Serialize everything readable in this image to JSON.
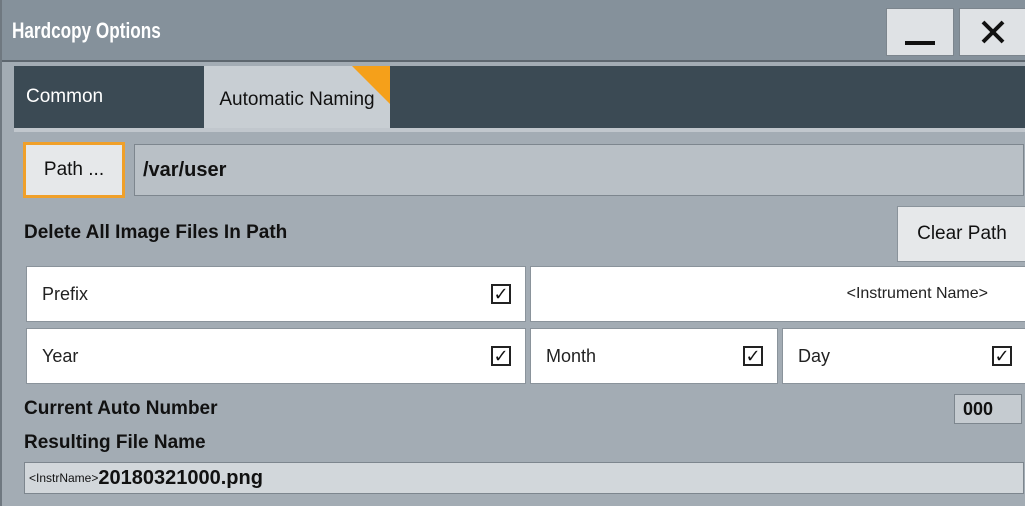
{
  "window": {
    "title": "Hardcopy Options",
    "minimize_icon": "minimize-icon",
    "close_icon": "close-icon",
    "close_glyph": "✕"
  },
  "tabs": [
    {
      "label": "Common",
      "active": false
    },
    {
      "label": "Automatic Naming",
      "active": true
    }
  ],
  "colors": {
    "accent": "#f5a01a",
    "titlebar": "#85919b",
    "tabbar": "#3b4a54",
    "panel": "#a3acb4"
  },
  "path": {
    "button_label": "Path ...",
    "value": "/var/user"
  },
  "delete": {
    "label": "Delete All Image Files In Path",
    "button_label": "Clear Path"
  },
  "naming": {
    "prefix": {
      "label": "Prefix",
      "checked": true,
      "value": "<Instrument Name>"
    },
    "year": {
      "label": "Year",
      "checked": true
    },
    "month": {
      "label": "Month",
      "checked": true
    },
    "day": {
      "label": "Day",
      "checked": true
    },
    "check_glyph": "✓"
  },
  "auto_number": {
    "label": "Current Auto Number",
    "value": "000"
  },
  "result": {
    "label": "Resulting File Name",
    "prefix": "<InstrName>",
    "filename": "20180321000.png"
  }
}
